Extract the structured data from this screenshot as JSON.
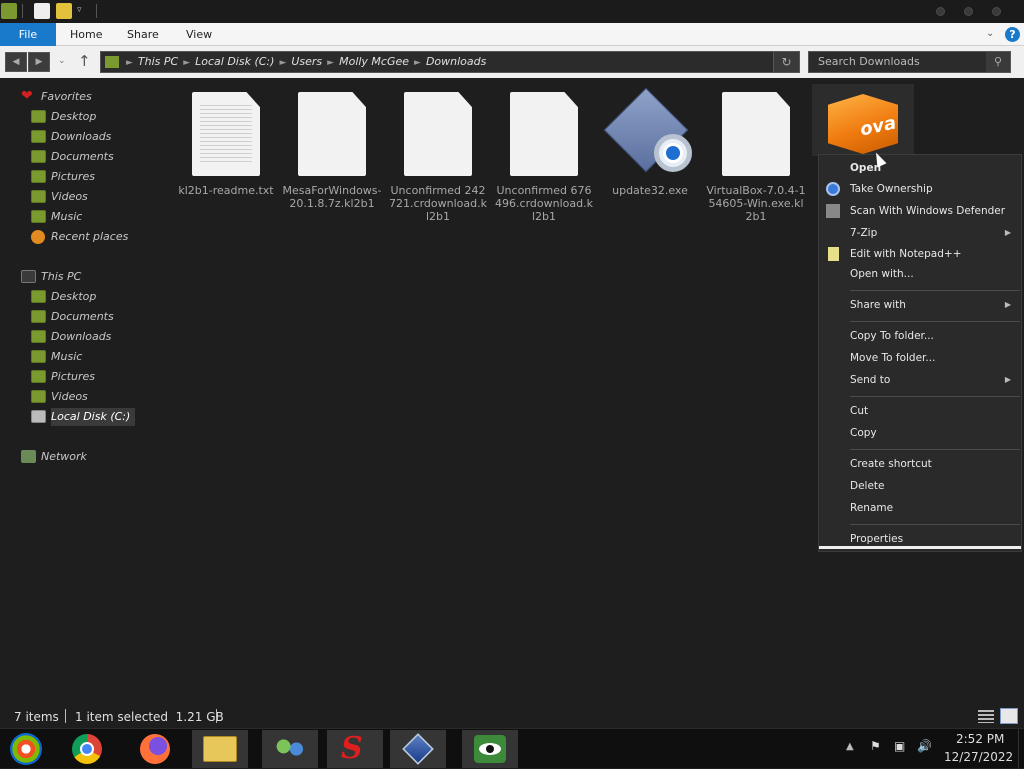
{
  "ribbon": {
    "tabs": [
      "File",
      "Home",
      "Share",
      "View"
    ]
  },
  "address": {
    "crumbs": [
      "This PC",
      "Local Disk (C:)",
      "Users",
      "Molly McGee",
      "Downloads"
    ],
    "search_placeholder": "Search Downloads"
  },
  "sidebar": {
    "favorites_label": "Favorites",
    "favorites": [
      "Desktop",
      "Downloads",
      "Documents",
      "Pictures",
      "Videos",
      "Music",
      "Recent places"
    ],
    "thispc_label": "This PC",
    "thispc": [
      "Desktop",
      "Documents",
      "Downloads",
      "Music",
      "Pictures",
      "Videos",
      "Local Disk (C:)"
    ],
    "network_label": "Network"
  },
  "files": [
    {
      "name": "kl2b1-readme.txt"
    },
    {
      "name": "MesaForWindows-20.1.8.7z.kl2b1"
    },
    {
      "name": "Unconfirmed 242721.crdownload.kl2b1"
    },
    {
      "name": "Unconfirmed 676496.crdownload.kl2b1"
    },
    {
      "name": "update32.exe"
    },
    {
      "name": "VirtualBox-7.0.4-154605-Win.exe.kl2b1"
    },
    {
      "name": "",
      "icon_text": "ova"
    }
  ],
  "context_menu": {
    "open": "Open",
    "take_ownership": "Take Ownership",
    "scan": "Scan With Windows Defender",
    "zip": "7-Zip",
    "notepad": "Edit with Notepad++",
    "open_with": "Open with...",
    "share_with": "Share with",
    "copy_to": "Copy To folder...",
    "move_to": "Move To folder...",
    "send_to": "Send to",
    "cut": "Cut",
    "copy": "Copy",
    "create_shortcut": "Create shortcut",
    "delete": "Delete",
    "rename": "Rename",
    "properties": "Properties"
  },
  "status": {
    "count": "7 items",
    "selected": "1 item selected  1.21 GB"
  },
  "clock": {
    "time": "2:52 PM",
    "date": "12/27/2022"
  },
  "colors": {
    "file_tab": "#1979ca",
    "background": "#1e1e1e",
    "menu_bg": "#2a2a2a"
  }
}
